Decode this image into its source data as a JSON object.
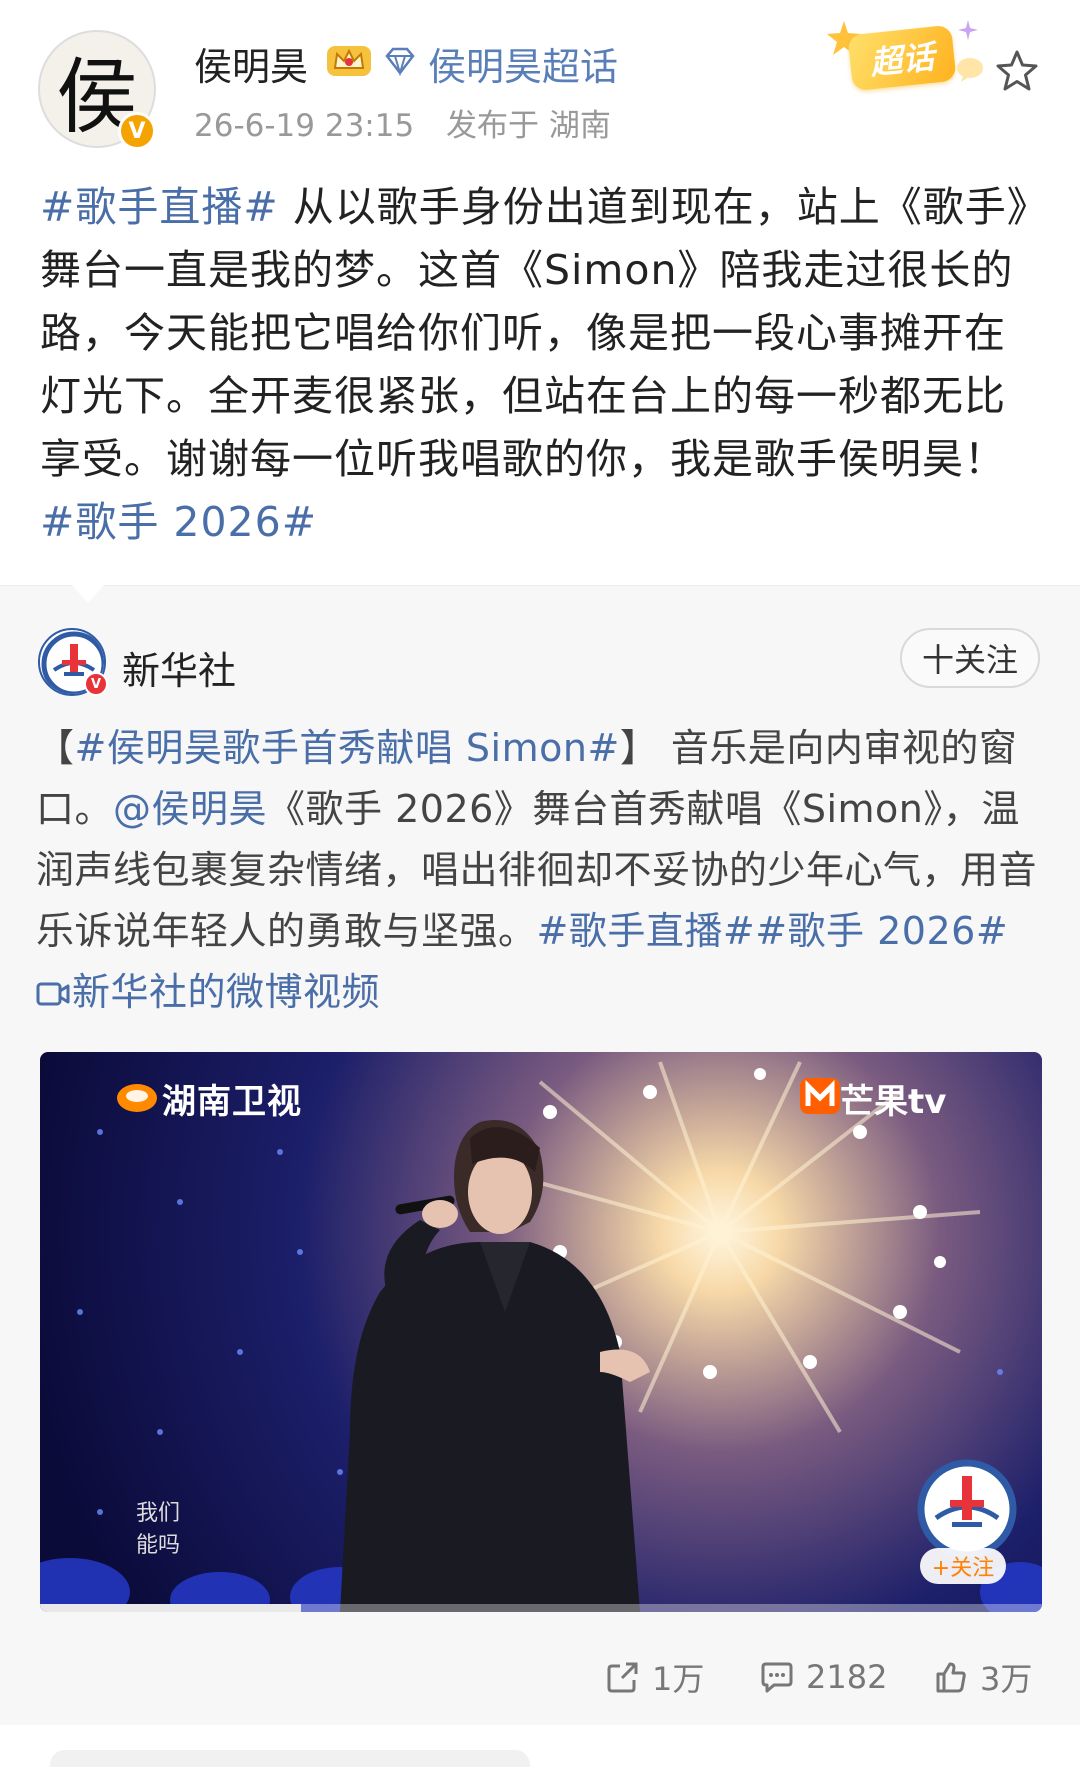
{
  "post": {
    "author": {
      "name": "侯明昊",
      "avatar_char": "侯",
      "verified_mark": "V",
      "supertopic_link": "侯明昊超话"
    },
    "timestamp": "26-6-19 23:15",
    "location": "发布于 湖南",
    "chaohua_badge": "超话",
    "text": {
      "tag_open": "#歌手直播#",
      "body": " 从以歌手身份出道到现在，站上《歌手》舞台一直是我的梦。这首《Simon》陪我走过很长的路，今天能把它唱给你们听，像是把一段心事摊开在灯光下。全开麦很紧张，但站在台上的每一秒都无比享受。谢谢每一位听我唱歌的你，我是歌手侯明昊！",
      "tag_close": "#歌手 2026#"
    }
  },
  "repost": {
    "author": {
      "name": "新华社",
      "verified_mark": "V"
    },
    "follow_label": "十关注",
    "text": {
      "bracket_open": "【",
      "tag_title": "#侯明昊歌手首秀献唱 Simon#",
      "bracket_close": "】",
      "part1": "音乐是向内审视的窗口。",
      "mention": "@侯明昊",
      "part2": "《歌手 2026》舞台首秀献唱《Simon》，温润声线包裹复杂情绪，唱出徘徊却不妥协的少年心气，用音乐诉说年轻人的勇敢与坚强。",
      "tag1": "#歌手直播#",
      "tag2": "#歌手 2026#",
      "video_link": "新华社的微博视频"
    },
    "video": {
      "watermark_left": "湖南卫视",
      "watermark_right": "芒果tv",
      "subtitle_line1": "我们",
      "subtitle_line2": "能吗",
      "follow_label": "+关注",
      "progress_fraction": 0.26
    }
  },
  "actions": {
    "share_count": "1万",
    "comment_count": "2182",
    "like_count": "3万"
  },
  "colors": {
    "link": "#4a6ea8",
    "badge_gold": "#f5a300",
    "xinhua_red": "#e8333a",
    "xinhua_blue": "#2f5aa6"
  }
}
